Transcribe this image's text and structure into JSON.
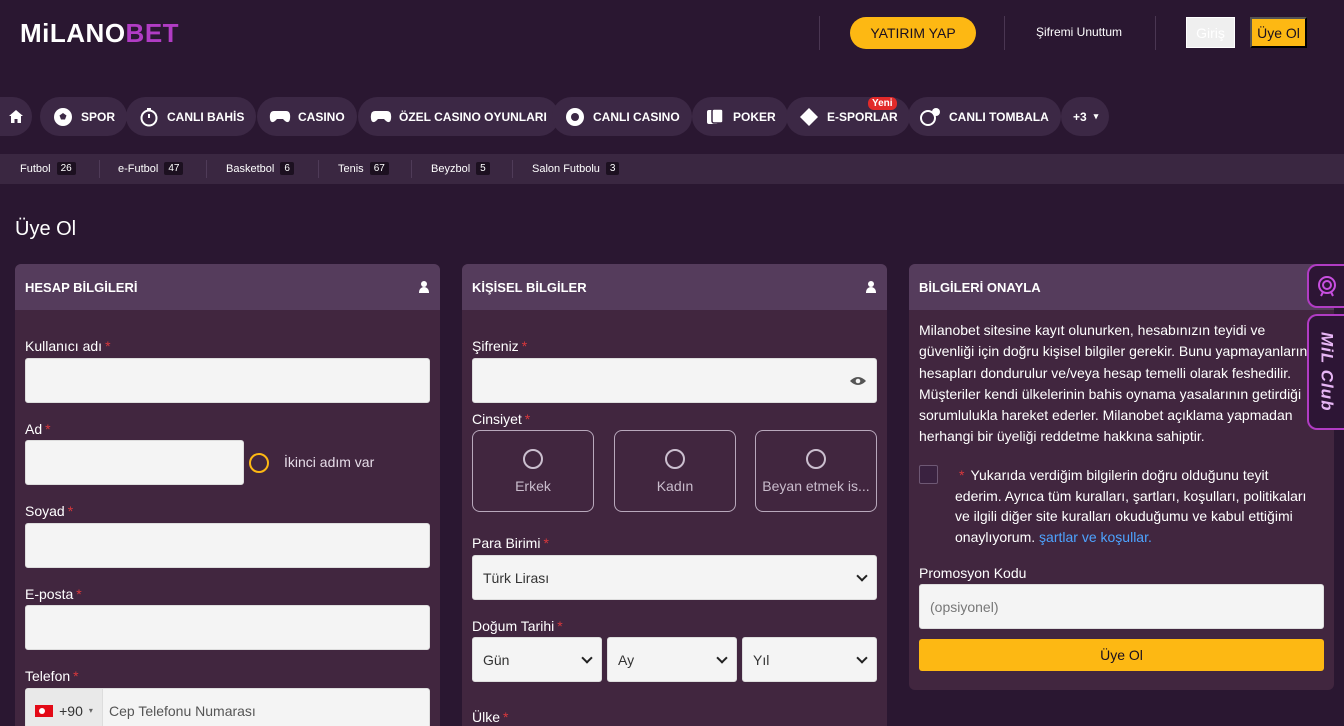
{
  "header": {
    "logo_white": "MiLANO",
    "logo_purple": "BET",
    "deposit_button": "YATIRIM YAP",
    "forgot_password": "Şifremi Unuttum",
    "login": "Giriş",
    "register": "Üye Ol"
  },
  "nav": [
    {
      "label": "SPOR",
      "icon": "soccer-ball-icon"
    },
    {
      "label": "CANLI BAHİS",
      "icon": "stopwatch-icon"
    },
    {
      "label": "CASINO",
      "icon": "gamepad-icon"
    },
    {
      "label": "ÖZEL CASINO OYUNLARI",
      "icon": "gamepad-icon"
    },
    {
      "label": "CANLI CASINO",
      "icon": "chip-icon"
    },
    {
      "label": "POKER",
      "icon": "cards-icon"
    },
    {
      "label": "E-SPORLAR",
      "icon": "esports-icon",
      "badge": "Yeni"
    },
    {
      "label": "CANLI TOMBALA",
      "icon": "bingo-icon"
    },
    {
      "label": "+3"
    }
  ],
  "subnav": [
    {
      "label": "Futbol",
      "count": "26"
    },
    {
      "label": "e-Futbol",
      "count": "47"
    },
    {
      "label": "Basketbol",
      "count": "6"
    },
    {
      "label": "Tenis",
      "count": "67"
    },
    {
      "label": "Beyzbol",
      "count": "5"
    },
    {
      "label": "Salon Futbolu",
      "count": "3"
    }
  ],
  "page_title": "Üye Ol",
  "account": {
    "title": "HESAP BİLGİLERİ",
    "username_label": "Kullanıcı adı",
    "name_label": "Ad",
    "second_step": "İkinci adım var",
    "surname_label": "Soyad",
    "email_label": "E-posta",
    "phone_label": "Telefon",
    "phone_code": "+90",
    "phone_placeholder": "Cep Telefonu Numarası"
  },
  "personal": {
    "title": "KİŞİSEL BİLGİLER",
    "password_label": "Şifreniz",
    "gender_label": "Cinsiyet",
    "gender_options": [
      "Erkek",
      "Kadın",
      "Beyan etmek is..."
    ],
    "currency_label": "Para Birimi",
    "currency_value": "Türk Lirası",
    "birth_label": "Doğum Tarihi",
    "day": "Gün",
    "month": "Ay",
    "year": "Yıl",
    "country_label": "Ülke"
  },
  "confirm": {
    "title": "BİLGİLERİ ONAYLA",
    "lines": [
      "Milanobet sitesine kayıt olunurken, hesabınızın teyidi ve",
      "güvenliği için doğru kişisel bilgiler gerekir. Bunu yapmayanların",
      "hesapları dondurulur ve/veya hesap temelli olarak feshedilir.",
      "Müşteriler kendi ülkelerinin bahis oynama yasalarının getirdiği",
      "sorumlulukla hareket ederler. Milanobet açıklama yapmadan",
      "herhangi bir üyeliği reddetme hakkına sahiptir."
    ],
    "terms_lines": [
      "Yukarıda verdiğim bilgilerin doğru olduğunu teyit",
      "ederim. Ayrıca tüm kuralları, şartları, koşulları, politikaları",
      "ve ilgili diğer site kuralları okuduğumu ve kabul ettiğimi"
    ],
    "terms_last": "onaylıyorum.",
    "terms_link": "şartlar ve koşullar.",
    "promo_label": "Promosyon Kodu",
    "promo_placeholder": "(opsiyonel)",
    "submit": "Üye Ol"
  },
  "side_club": "MiL Club",
  "colors": {
    "accent": "#fdb813",
    "brand": "#b13cc4",
    "bg": "#2a1731",
    "panel": "#41263f"
  }
}
